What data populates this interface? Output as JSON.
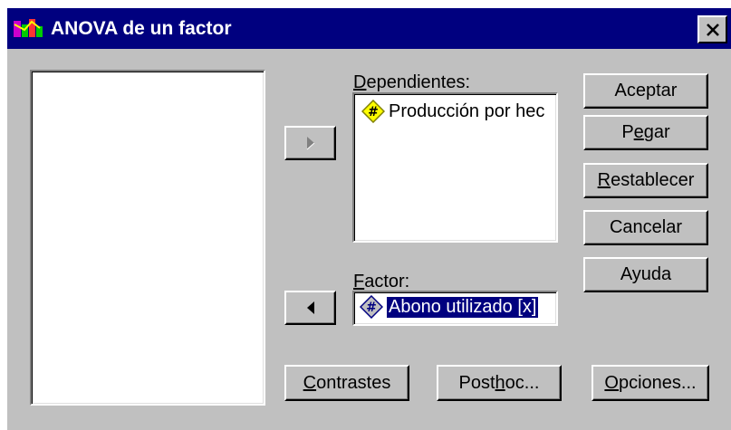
{
  "window": {
    "title": "ANOVA de un factor",
    "close_glyph": "✕"
  },
  "variables_list": {
    "items": []
  },
  "dependents": {
    "label_first": "D",
    "label_rest": "ependientes:",
    "items": [
      {
        "name": "Producción por hec",
        "icon": "scale-variable-icon"
      }
    ]
  },
  "factor": {
    "label_first": "F",
    "label_rest": "actor:",
    "value": "Abono utilizado [x]",
    "icon": "scale-variable-icon-selected"
  },
  "buttons": {
    "aceptar": "Aceptar",
    "pegar_a": "P",
    "pegar_u": "e",
    "pegar_b": "gar",
    "restablecer_u": "R",
    "restablecer_rest": "establecer",
    "cancelar": "Cancelar",
    "ayuda": "Ayuda",
    "contrastes_u": "C",
    "contrastes_rest": "ontrastes",
    "posthoc_a": "Post ",
    "posthoc_u": "h",
    "posthoc_b": "oc...",
    "opciones_u": "O",
    "opciones_rest": "pciones..."
  },
  "arrows": {
    "move_to_dependents": "right-arrow-icon",
    "move_from_factor": "left-arrow-icon"
  },
  "colors": {
    "titlebar": "#00007f",
    "face": "#c0c0c0",
    "selection": "#00007f",
    "icon_yellow": "#ffff00"
  }
}
